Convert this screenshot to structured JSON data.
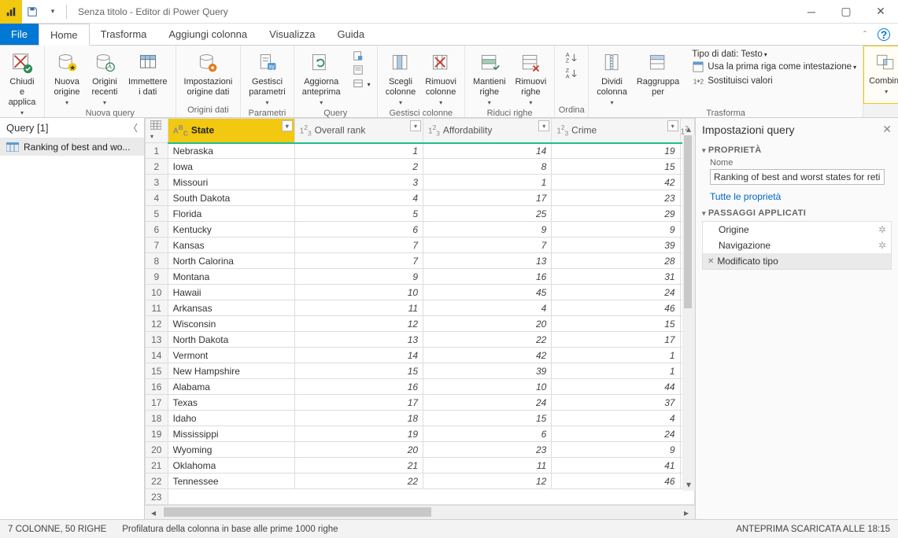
{
  "title": "Senza titolo - Editor di Power Query",
  "tabs": {
    "file": "File",
    "home": "Home",
    "trasforma": "Trasforma",
    "aggiungi": "Aggiungi colonna",
    "visualizza": "Visualizza",
    "guida": "Guida"
  },
  "ribbon": {
    "chiudi": {
      "label": "Chiudi e\napplica",
      "group": "Chiudi"
    },
    "nuova_origine": "Nuova\norigine",
    "origini_recenti": "Origini\nrecenti",
    "immettere": "Immettere\ni dati",
    "group_nuova": "Nuova query",
    "impostazioni_origine": "Impostazioni\norigine dati",
    "group_origini": "Origini dati",
    "gestisci_param": "Gestisci\nparametri",
    "group_param": "Parametri",
    "aggiorna": "Aggiorna\nanteprima",
    "prop_icon": "",
    "group_query": "Query",
    "scegli_col": "Scegli\ncolonne",
    "rimuovi_col": "Rimuovi\ncolonne",
    "group_gestcol": "Gestisci colonne",
    "mantieni": "Mantieni\nrighe",
    "rimuovi_righe": "Rimuovi\nrighe",
    "group_riduci": "Riduci righe",
    "group_ordina": "Ordina",
    "dividi": "Dividi\ncolonna",
    "raggruppa": "Raggruppa\nper",
    "tipo_dati": "Tipo di dati: Testo",
    "prima_riga": "Usa la prima riga come intestazione",
    "sostituisci": "Sostituisci valori",
    "group_trasforma": "Trasforma",
    "combina": "Combina"
  },
  "queries": {
    "title": "Query [1]",
    "item": "Ranking of best and wo..."
  },
  "grid": {
    "columns": [
      "State",
      "Overall rank",
      "Affordability",
      "Crime"
    ],
    "rows": [
      {
        "n": 1,
        "state": "Nebraska",
        "c": [
          1,
          14,
          19
        ]
      },
      {
        "n": 2,
        "state": "Iowa",
        "c": [
          2,
          8,
          15
        ]
      },
      {
        "n": 3,
        "state": "Missouri",
        "c": [
          3,
          1,
          42
        ]
      },
      {
        "n": 4,
        "state": "South Dakota",
        "c": [
          4,
          17,
          23
        ]
      },
      {
        "n": 5,
        "state": "Florida",
        "c": [
          5,
          25,
          29
        ]
      },
      {
        "n": 6,
        "state": "Kentucky",
        "c": [
          6,
          9,
          9
        ]
      },
      {
        "n": 7,
        "state": "Kansas",
        "c": [
          7,
          7,
          39
        ]
      },
      {
        "n": 8,
        "state": "North Calorina",
        "c": [
          7,
          13,
          28
        ]
      },
      {
        "n": 9,
        "state": "Montana",
        "c": [
          9,
          16,
          31
        ]
      },
      {
        "n": 10,
        "state": "Hawaii",
        "c": [
          10,
          45,
          24
        ]
      },
      {
        "n": 11,
        "state": "Arkansas",
        "c": [
          11,
          4,
          46
        ]
      },
      {
        "n": 12,
        "state": "Wisconsin",
        "c": [
          12,
          20,
          15
        ]
      },
      {
        "n": 13,
        "state": "North Dakota",
        "c": [
          13,
          22,
          17
        ]
      },
      {
        "n": 14,
        "state": "Vermont",
        "c": [
          14,
          42,
          1
        ]
      },
      {
        "n": 15,
        "state": "New Hampshire",
        "c": [
          15,
          39,
          1
        ]
      },
      {
        "n": 16,
        "state": "Alabama",
        "c": [
          16,
          10,
          44
        ]
      },
      {
        "n": 17,
        "state": "Texas",
        "c": [
          17,
          24,
          37
        ]
      },
      {
        "n": 18,
        "state": "Idaho",
        "c": [
          18,
          15,
          4
        ]
      },
      {
        "n": 19,
        "state": "Mississippi",
        "c": [
          19,
          6,
          24
        ]
      },
      {
        "n": 20,
        "state": "Wyoming",
        "c": [
          20,
          23,
          9
        ]
      },
      {
        "n": 21,
        "state": "Oklahoma",
        "c": [
          21,
          11,
          41
        ]
      },
      {
        "n": 22,
        "state": "Tennessee",
        "c": [
          22,
          12,
          46
        ]
      }
    ]
  },
  "settings": {
    "title": "Impostazioni query",
    "sect_prop": "PROPRIETÀ",
    "name_label": "Nome",
    "name_value": "Ranking of best and worst states for retire",
    "all_props": "Tutte le proprietà",
    "sect_steps": "PASSAGGI APPLICATI",
    "steps": [
      "Origine",
      "Navigazione",
      "Modificato tipo"
    ]
  },
  "status": {
    "cols": "7 COLONNE, 50 RIGHE",
    "profile": "Profilatura della colonna in base alle prime 1000 righe",
    "right": "ANTEPRIMA SCARICATA ALLE 18:15"
  }
}
